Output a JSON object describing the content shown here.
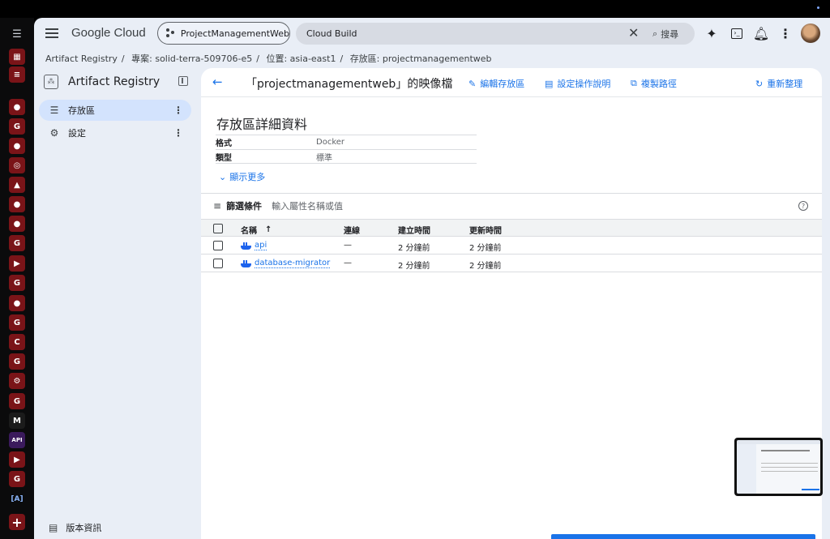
{
  "topbar": {
    "brand": "Google Cloud",
    "project": "ProjectManagementWeb",
    "search_value": "Cloud Build",
    "search_button": "搜尋"
  },
  "breadcrumb": [
    "Artifact Registry",
    "專案: solid-terra-509706-e5",
    "位置: asia-east1",
    "存放區: projectmanagementweb"
  ],
  "sidebar": {
    "product": "Artifact Registry",
    "items": [
      {
        "label": "存放區",
        "icon": "list-icon",
        "active": true
      },
      {
        "label": "設定",
        "icon": "gear-icon",
        "active": false
      }
    ],
    "footer": "版本資訊"
  },
  "page": {
    "title": "「projectmanagementweb」的映像檔",
    "actions": {
      "edit": "編輯存放區",
      "setup": "設定操作說明",
      "copy": "複製路徑",
      "refresh": "重新整理"
    },
    "details_title": "存放區詳細資料",
    "details": [
      {
        "key": "格式",
        "value": "Docker"
      },
      {
        "key": "類型",
        "value": "標準"
      }
    ],
    "show_more": "顯示更多",
    "filter_label": "篩選條件",
    "filter_placeholder": "輸入屬性名稱或值"
  },
  "table": {
    "headers": {
      "name": "名稱",
      "connection": "連線",
      "created": "建立時間",
      "updated": "更新時間"
    },
    "rows": [
      {
        "name": "api",
        "connection": "—",
        "created": "2 分鐘前",
        "updated": "2 分鐘前"
      },
      {
        "name": "database-migrator",
        "connection": "—",
        "created": "2 分鐘前",
        "updated": "2 分鐘前"
      }
    ]
  },
  "dock": {
    "items": [
      "github",
      "google",
      "github",
      "globe",
      "drive",
      "github",
      "github",
      "google",
      "youtube",
      "google",
      "github",
      "g",
      "c",
      "g",
      "settings",
      "google",
      "medium",
      "api",
      "youtube",
      "google",
      "brackets"
    ],
    "api_label": "API",
    "medium_label": "M"
  },
  "colors": {
    "accent": "#1a73e8",
    "active_nav": "#d3e3fd",
    "surface": "#e9eef6",
    "dock_tile": "#7a1418"
  }
}
